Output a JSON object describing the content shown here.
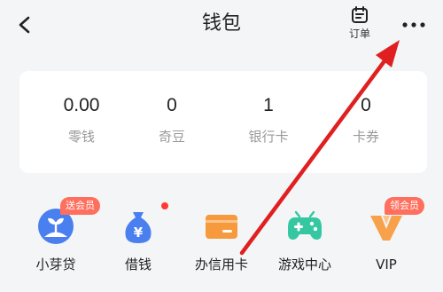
{
  "header": {
    "title": "钱包",
    "order_label": "订单",
    "back_icon": "chevron-left-icon",
    "order_icon": "receipt-icon",
    "more_icon": "more-dots-icon"
  },
  "stats": [
    {
      "value": "0.00",
      "label": "零钱"
    },
    {
      "value": "0",
      "label": "奇豆"
    },
    {
      "value": "1",
      "label": "银行卡"
    },
    {
      "value": "0",
      "label": "卡券"
    }
  ],
  "shortcuts": [
    {
      "label": "小芽贷",
      "badge": "送会员",
      "icon": "sprout-icon"
    },
    {
      "label": "借钱",
      "icon": "money-bag-icon",
      "has_dot": true
    },
    {
      "label": "办信用卡",
      "icon": "credit-card-icon"
    },
    {
      "label": "游戏中心",
      "icon": "gamepad-icon"
    },
    {
      "label": "VIP",
      "badge": "领会员",
      "icon": "vip-icon"
    }
  ],
  "colors": {
    "background": "#f4f5f7",
    "card": "#ffffff",
    "accent_blue": "#4a7ff0",
    "accent_orange": "#f79a3e",
    "accent_green": "#34c7a1",
    "badge": "#ff6f5e",
    "annotation_arrow": "#e02020"
  }
}
